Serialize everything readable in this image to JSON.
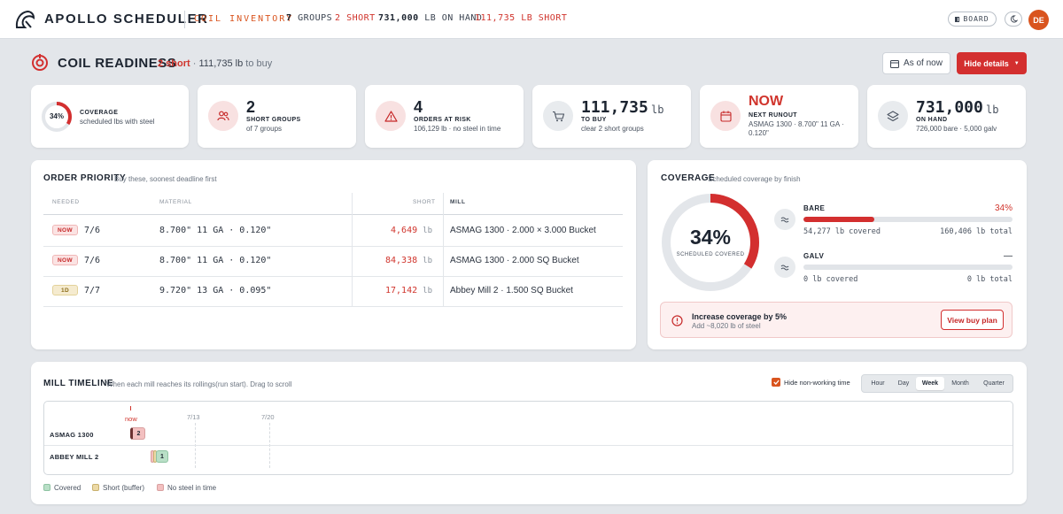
{
  "topbar": {
    "brand": "APOLLO SCHEDULER",
    "section": "COIL INVENTORY",
    "groups_num": "7",
    "groups_lbl": "GROUPS",
    "short_num": "2",
    "short_lbl": "SHORT",
    "onhand_num": "731,000",
    "onhand_lbl": "LB ON HAND",
    "shortlb_num": "111,735",
    "shortlb_lbl": "LB SHORT",
    "board_label": "BOARD",
    "avatar": "DE",
    "brand_color": "#d9541e"
  },
  "header": {
    "title": "COIL READINESS",
    "short": "2 short",
    "sep": "·",
    "amount": "111,735 lb",
    "to_buy": "to buy",
    "asof_label": "As of now",
    "hide_label": "Hide details"
  },
  "kpis": {
    "coverage": {
      "pct": "34%",
      "fraction": 0.34,
      "label": "COVERAGE",
      "sub": "scheduled lbs with steel"
    },
    "short_groups": {
      "value": "2",
      "label": "SHORT GROUPS",
      "sub": "of 7 groups"
    },
    "orders_at_risk": {
      "value": "4",
      "label": "ORDERS AT RISK",
      "sub": "106,129 lb · no steel in time"
    },
    "to_buy": {
      "value": "111,735",
      "unit": "lb",
      "label": "TO BUY",
      "sub": "clear 2 short groups"
    },
    "next_runout": {
      "value": "NOW",
      "label": "NEXT RUNOUT",
      "sub1": "ASMAG 1300 · 8.700\" 11 GA ·",
      "sub2": "0.120\""
    },
    "on_hand": {
      "value": "731,000",
      "unit": "lb",
      "label": "ON HAND",
      "sub": "726,000 bare · 5,000 galv"
    }
  },
  "orders": {
    "title": "ORDER PRIORITY",
    "subtitle": "Buy these, soonest deadline first",
    "columns": {
      "needed": "NEEDED",
      "material": "MATERIAL",
      "short": "SHORT",
      "mill": "MILL"
    },
    "rows": [
      {
        "chip": "NOW",
        "date": "7/6",
        "material": "8.700\" 11 GA · 0.120\"",
        "short": "4,649",
        "unit": "lb",
        "mill": "ASMAG 1300 · 2.000 × 3.000 Bucket"
      },
      {
        "chip": "NOW",
        "date": "7/6",
        "material": "8.700\" 11 GA · 0.120\"",
        "short": "84,338",
        "unit": "lb",
        "mill": "ASMAG 1300 · 2.000 SQ Bucket"
      },
      {
        "chip": "1D",
        "date": "7/7",
        "material": "9.720\" 13 GA · 0.095\"",
        "short": "17,142",
        "unit": "lb",
        "mill": "Abbey Mill 2 · 1.500 SQ Bucket"
      }
    ]
  },
  "coverage": {
    "title": "COVERAGE",
    "subtitle": "Scheduled coverage by finish",
    "donut_pct": "34%",
    "donut_fraction": 0.34,
    "donut_label": "SCHEDULED COVERED",
    "bare": {
      "name": "BARE",
      "pct": "34%",
      "fraction": 0.34,
      "covered": "54,277 lb covered",
      "total": "160,406 lb total"
    },
    "galv": {
      "name": "GALV",
      "pct": "—",
      "fraction": 0,
      "covered": "0 lb covered",
      "total": "0 lb total"
    },
    "alert_title": "Increase coverage by 5%",
    "alert_sub": "Add ~8,020 lb of steel",
    "buy_label": "View buy plan",
    "accent": "#d32f2f"
  },
  "timeline": {
    "title": "MILL TIMELINE",
    "subtitle": "When each mill reaches its rollings(run start). Drag to scroll",
    "hide_nonworking": "Hide non-working time",
    "ranges": [
      "Hour",
      "Day",
      "Week",
      "Month",
      "Quarter"
    ],
    "active_range": "Week",
    "now_label": "now",
    "ticks": [
      "7/13",
      "7/20"
    ],
    "mills": [
      {
        "name": "ASMAG 1300",
        "count": "2"
      },
      {
        "name": "ABBEY MILL 2",
        "count": "1"
      }
    ],
    "legend": [
      {
        "label": "Covered",
        "color": "#b9dfc7"
      },
      {
        "label": "Short (buffer)",
        "color": "#ecd9a6"
      },
      {
        "label": "No steel in time",
        "color": "#f3c0c0"
      }
    ]
  }
}
